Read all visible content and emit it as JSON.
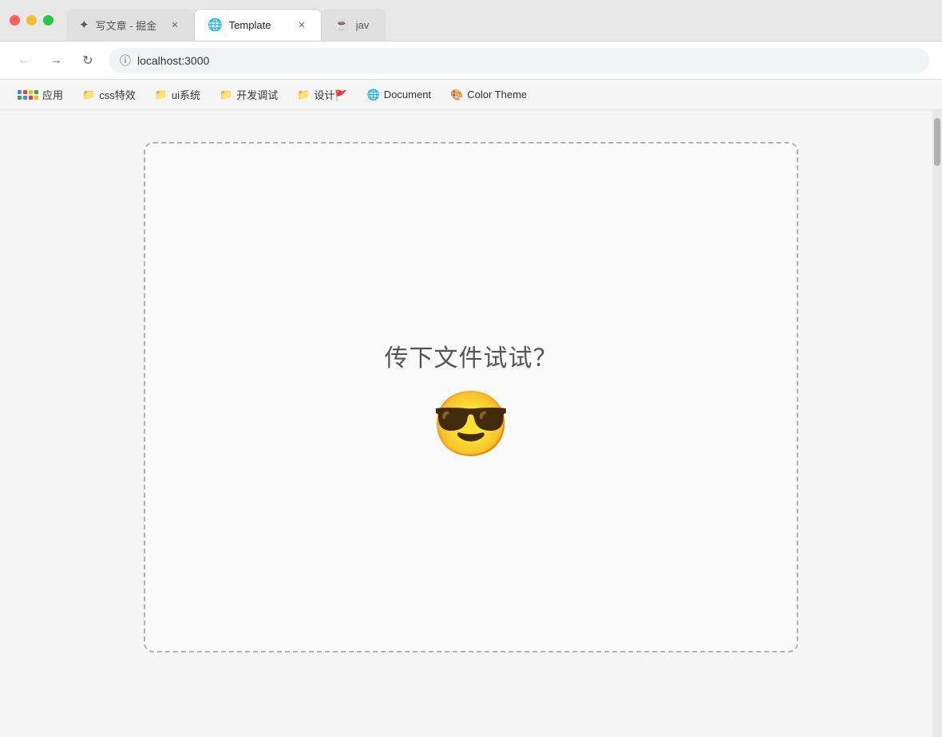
{
  "titleBar": {
    "tabs": [
      {
        "id": "tab1",
        "icon": "✦",
        "label": "写文章 - 掘金",
        "active": false,
        "closable": true
      },
      {
        "id": "tab2",
        "icon": "🌐",
        "label": "Template",
        "active": true,
        "closable": true
      },
      {
        "id": "tab3",
        "icon": "☕",
        "label": "jav",
        "active": false,
        "closable": false,
        "partial": true
      }
    ]
  },
  "addressBar": {
    "url": "localhost:3000",
    "back_title": "Back",
    "forward_title": "Forward",
    "reload_title": "Reload"
  },
  "bookmarksBar": {
    "items": [
      {
        "id": "apps",
        "icon": "grid",
        "label": "应用"
      },
      {
        "id": "css",
        "icon": "folder",
        "label": "css特效"
      },
      {
        "id": "ui",
        "icon": "folder",
        "label": "ui系统"
      },
      {
        "id": "devtools",
        "icon": "folder",
        "label": "开发调试"
      },
      {
        "id": "design",
        "icon": "folder",
        "label": "设计🚩"
      },
      {
        "id": "document",
        "icon": "globe",
        "label": "Document"
      },
      {
        "id": "colortheme",
        "icon": "color",
        "label": "Color Theme"
      }
    ]
  },
  "mainContent": {
    "dropZone": {
      "text": "传下文件试试？",
      "emoji": "😎"
    }
  }
}
